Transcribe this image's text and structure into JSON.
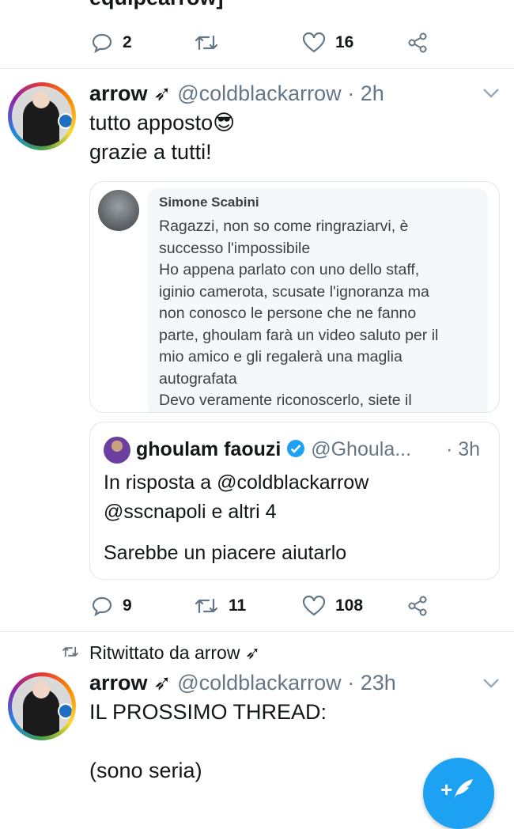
{
  "top_fragment": "equipearrow]",
  "first_actions": {
    "replies": "2",
    "retweets": "",
    "likes": "16"
  },
  "tweet1": {
    "display_name": "arrow",
    "rocket": "➶",
    "handle": "@coldblackarrow",
    "sep": "·",
    "time": "2h",
    "text_line1": "tutto apposto",
    "emoji": "😎",
    "text_line2": "grazie a tutti!",
    "screenshot": {
      "name": "Simone Scabini",
      "lines": [
        "Ragazzi, non so come ringraziarvi, è",
        "successo l'impossibile",
        "Ho appena parlato con uno dello staff,",
        "iginio camerota, scusate l'ignoranza ma",
        "non conosco le persone che ne fanno",
        "parte, ghoulam farà un video saluto per il",
        "mio amico e gli regalerà una maglia",
        "autografata",
        "Devo veramente riconoscerlo, siete il"
      ]
    },
    "quote": {
      "name": "ghoulam faouzi",
      "handle": "@Ghoula...",
      "sep": "·",
      "time": "3h",
      "reply_line1": "In risposta a @coldblackarrow",
      "reply_line2": "@sscnapoli e altri 4",
      "text": "Sarebbe un piacere aiutarlo"
    },
    "actions": {
      "replies": "9",
      "retweets": "11",
      "likes": "108"
    }
  },
  "retweet_label": "Ritwittato da arrow",
  "tweet2": {
    "display_name": "arrow",
    "rocket": "➶",
    "handle": "@coldblackarrow",
    "sep": "·",
    "time": "23h",
    "line1": "IL PROSSIMO THREAD:",
    "line2": "(sono seria)"
  },
  "fab_plus": "+",
  "colors": {
    "accent": "#1da1f2",
    "verified": "#1da1f2",
    "muted": "#657786",
    "divider": "#e6ecf0"
  }
}
